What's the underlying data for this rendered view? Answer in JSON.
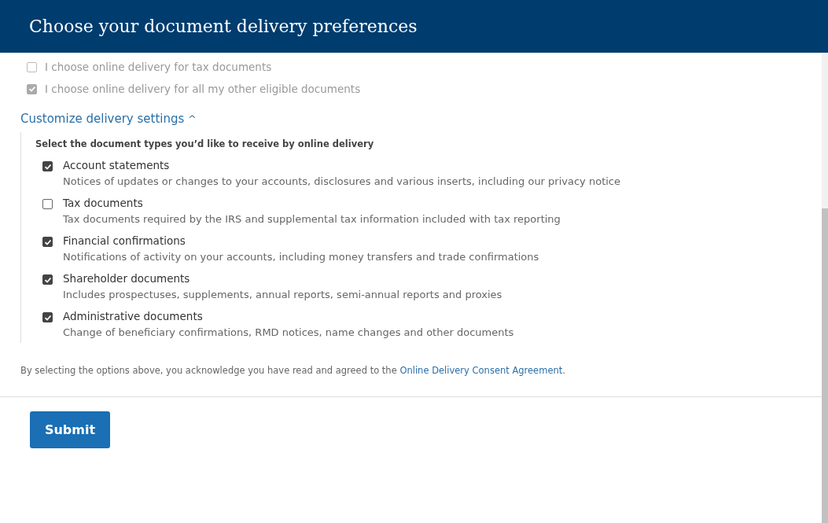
{
  "header": {
    "title": "Choose your document delivery preferences"
  },
  "global_options": [
    {
      "label": "I choose online delivery for tax documents",
      "checked": false,
      "disabled": true
    },
    {
      "label": "I choose online delivery for all my other eligible documents",
      "checked": true,
      "disabled": true
    }
  ],
  "customize": {
    "label": "Customize delivery settings",
    "caret": "^",
    "expanded": true,
    "heading": "Select the document types you’d like to receive by online delivery",
    "options": [
      {
        "label": "Account statements",
        "description": "Notices of updates or changes to your accounts, disclosures and various inserts, including our privacy notice",
        "checked": true
      },
      {
        "label": "Tax documents",
        "description": "Tax documents required by the IRS and supplemental tax information included with tax reporting",
        "checked": false
      },
      {
        "label": "Financial confirmations",
        "description": "Notifications of activity on your accounts, including money transfers and trade confirmations",
        "checked": true
      },
      {
        "label": "Shareholder documents",
        "description": "Includes prospectuses, supplements, annual reports, semi-annual reports and proxies",
        "checked": true
      },
      {
        "label": "Administrative documents",
        "description": "Change of beneficiary confirmations, RMD notices, name changes and other documents",
        "checked": true
      }
    ]
  },
  "consent": {
    "text": "By selecting the options above, you acknowledge you have read and agreed to the",
    "link": "Online Delivery Consent Agreement",
    "end": "."
  },
  "submit": {
    "label": "Submit"
  }
}
